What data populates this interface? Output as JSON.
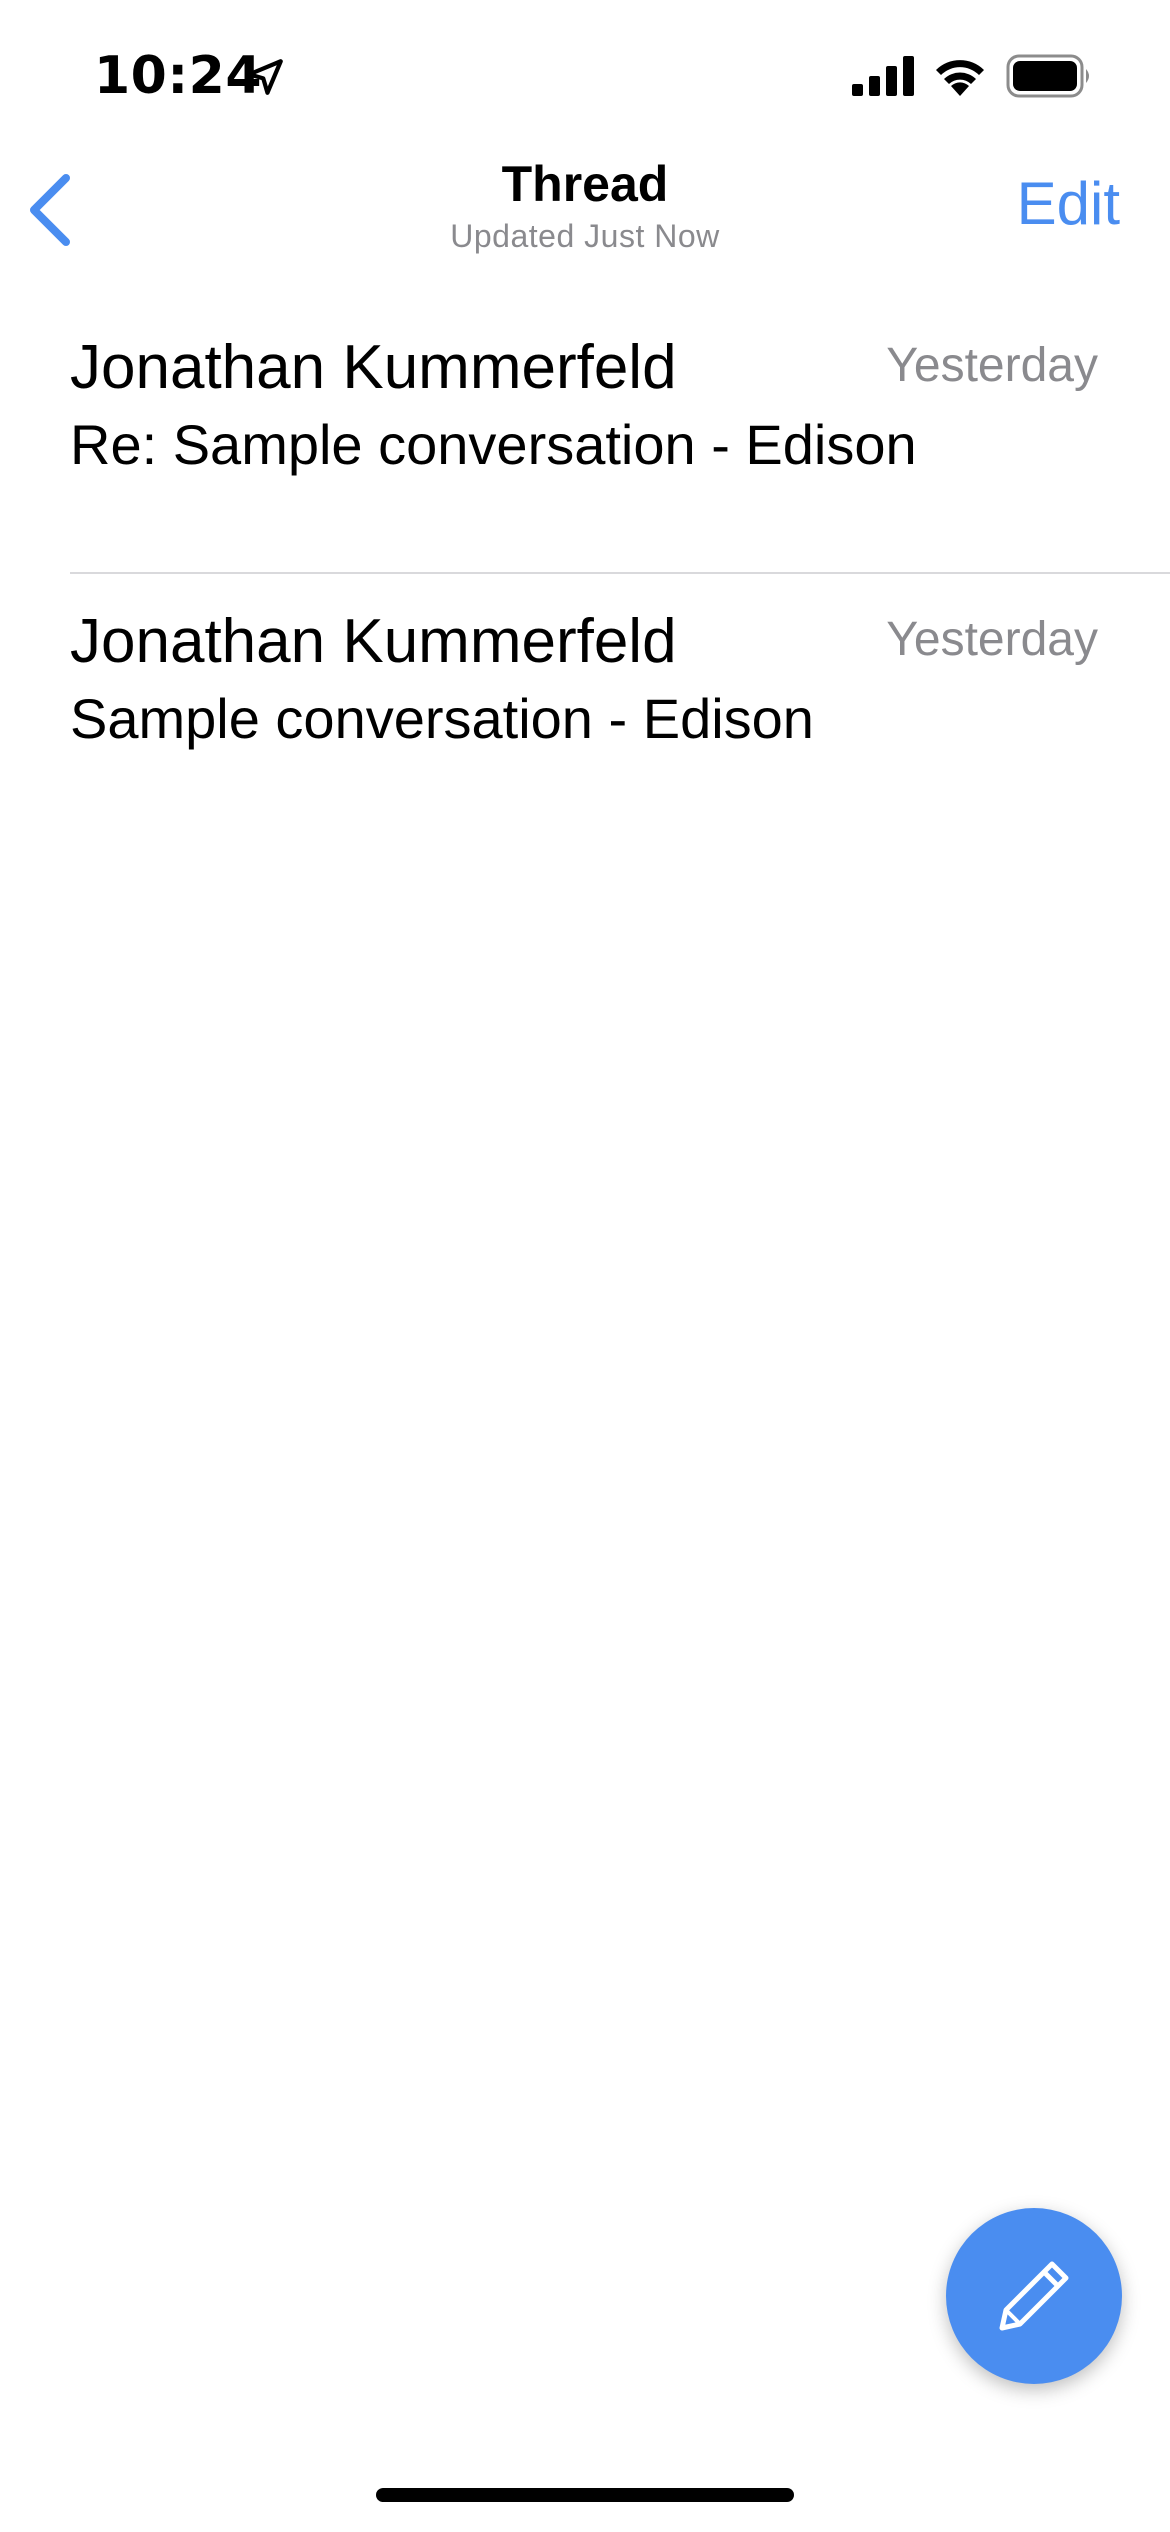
{
  "status_bar": {
    "time": "10:24",
    "icons": [
      "location-arrow-icon",
      "cellular-signal-icon",
      "wifi-icon",
      "battery-icon"
    ]
  },
  "nav": {
    "back_icon": "chevron-left-icon",
    "title": "Thread",
    "subtitle": "Updated Just Now",
    "edit_label": "Edit"
  },
  "threads": [
    {
      "sender": "Jonathan Kummerfeld",
      "date": "Yesterday",
      "subject": "Re: Sample conversation - Edison"
    },
    {
      "sender": "Jonathan Kummerfeld",
      "date": "Yesterday",
      "subject": "Sample conversation - Edison"
    }
  ],
  "compose": {
    "icon": "pencil-icon"
  },
  "colors": {
    "accent": "#4a8df0",
    "secondary_text": "#8a8a8e",
    "divider": "#d9d9dc"
  }
}
